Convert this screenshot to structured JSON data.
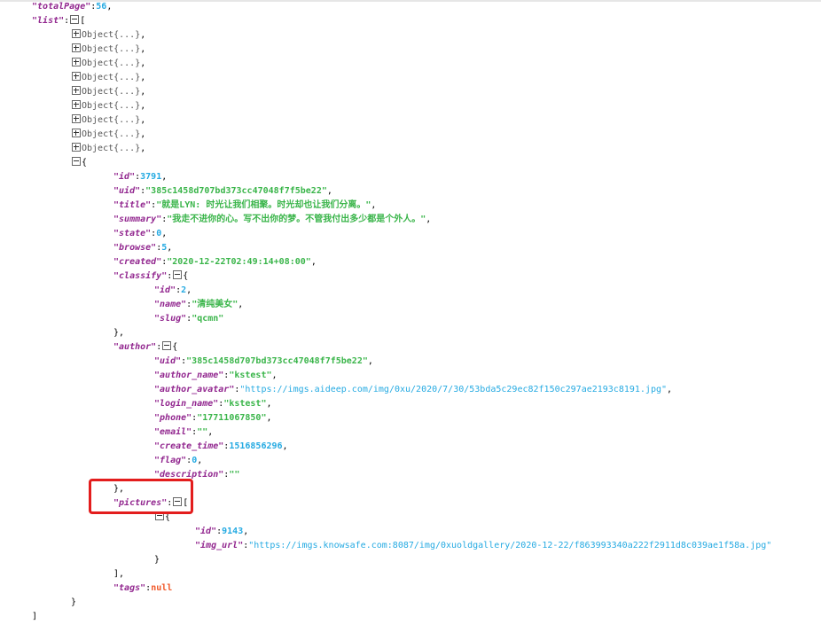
{
  "json_view": {
    "totalPage": {
      "key": "totalPage",
      "value": "56"
    },
    "list_key": "list",
    "collapsed_label": "Object{...}",
    "object": {
      "id": {
        "key": "id",
        "value": "3791"
      },
      "uid": {
        "key": "uid",
        "value": "\"385c1458d707bd373cc47048f7f5be22\""
      },
      "title": {
        "key": "title",
        "value": "\"就是LYN: 时光让我们相聚。时光却也让我们分离。\""
      },
      "summary": {
        "key": "summary",
        "value": "\"我走不进你的心。写不出你的梦。不管我付出多少都是个外人。\""
      },
      "state": {
        "key": "state",
        "value": "0"
      },
      "browse": {
        "key": "browse",
        "value": "5"
      },
      "created": {
        "key": "created",
        "value": "\"2020-12-22T02:49:14+08:00\""
      },
      "classify": {
        "key": "classify",
        "id": {
          "key": "id",
          "value": "2"
        },
        "name": {
          "key": "name",
          "value": "\"清纯美女\""
        },
        "slug": {
          "key": "slug",
          "value": "\"qcmn\""
        }
      },
      "author": {
        "key": "author",
        "uid": {
          "key": "uid",
          "value": "\"385c1458d707bd373cc47048f7f5be22\""
        },
        "author_name": {
          "key": "author_name",
          "value": "\"kstest\""
        },
        "author_avatar": {
          "key": "author_avatar",
          "value": "\"https://imgs.aideep.com/img/0xu/2020/7/30/53bda5c29ec82f150c297ae2193c8191.jpg\""
        },
        "login_name": {
          "key": "login_name",
          "value": "\"kstest\""
        },
        "phone": {
          "key": "phone",
          "value": "\"17711067850\""
        },
        "email": {
          "key": "email",
          "value": "\"\""
        },
        "create_time": {
          "key": "create_time",
          "value": "1516856296"
        },
        "flag": {
          "key": "flag",
          "value": "0"
        },
        "description": {
          "key": "description",
          "value": "\"\""
        }
      },
      "pictures": {
        "key": "pictures",
        "id": {
          "key": "id",
          "value": "9143"
        },
        "img_url": {
          "key": "img_url",
          "value": "\"https://imgs.knowsafe.com:8087/img/0xuoldgallery/2020-12-22/f863993340a222f2911d8c039ae1f58a.jpg\""
        }
      },
      "tags": {
        "key": "tags",
        "value": "null"
      }
    }
  },
  "colors": {
    "key": "#92278f",
    "string": "#3ab54a",
    "number": "#25aae2",
    "null": "#f1592a",
    "highlight_box": "#e31d1d"
  },
  "icons": {
    "expand": "plus-square-icon",
    "collapse": "minus-square-icon"
  }
}
